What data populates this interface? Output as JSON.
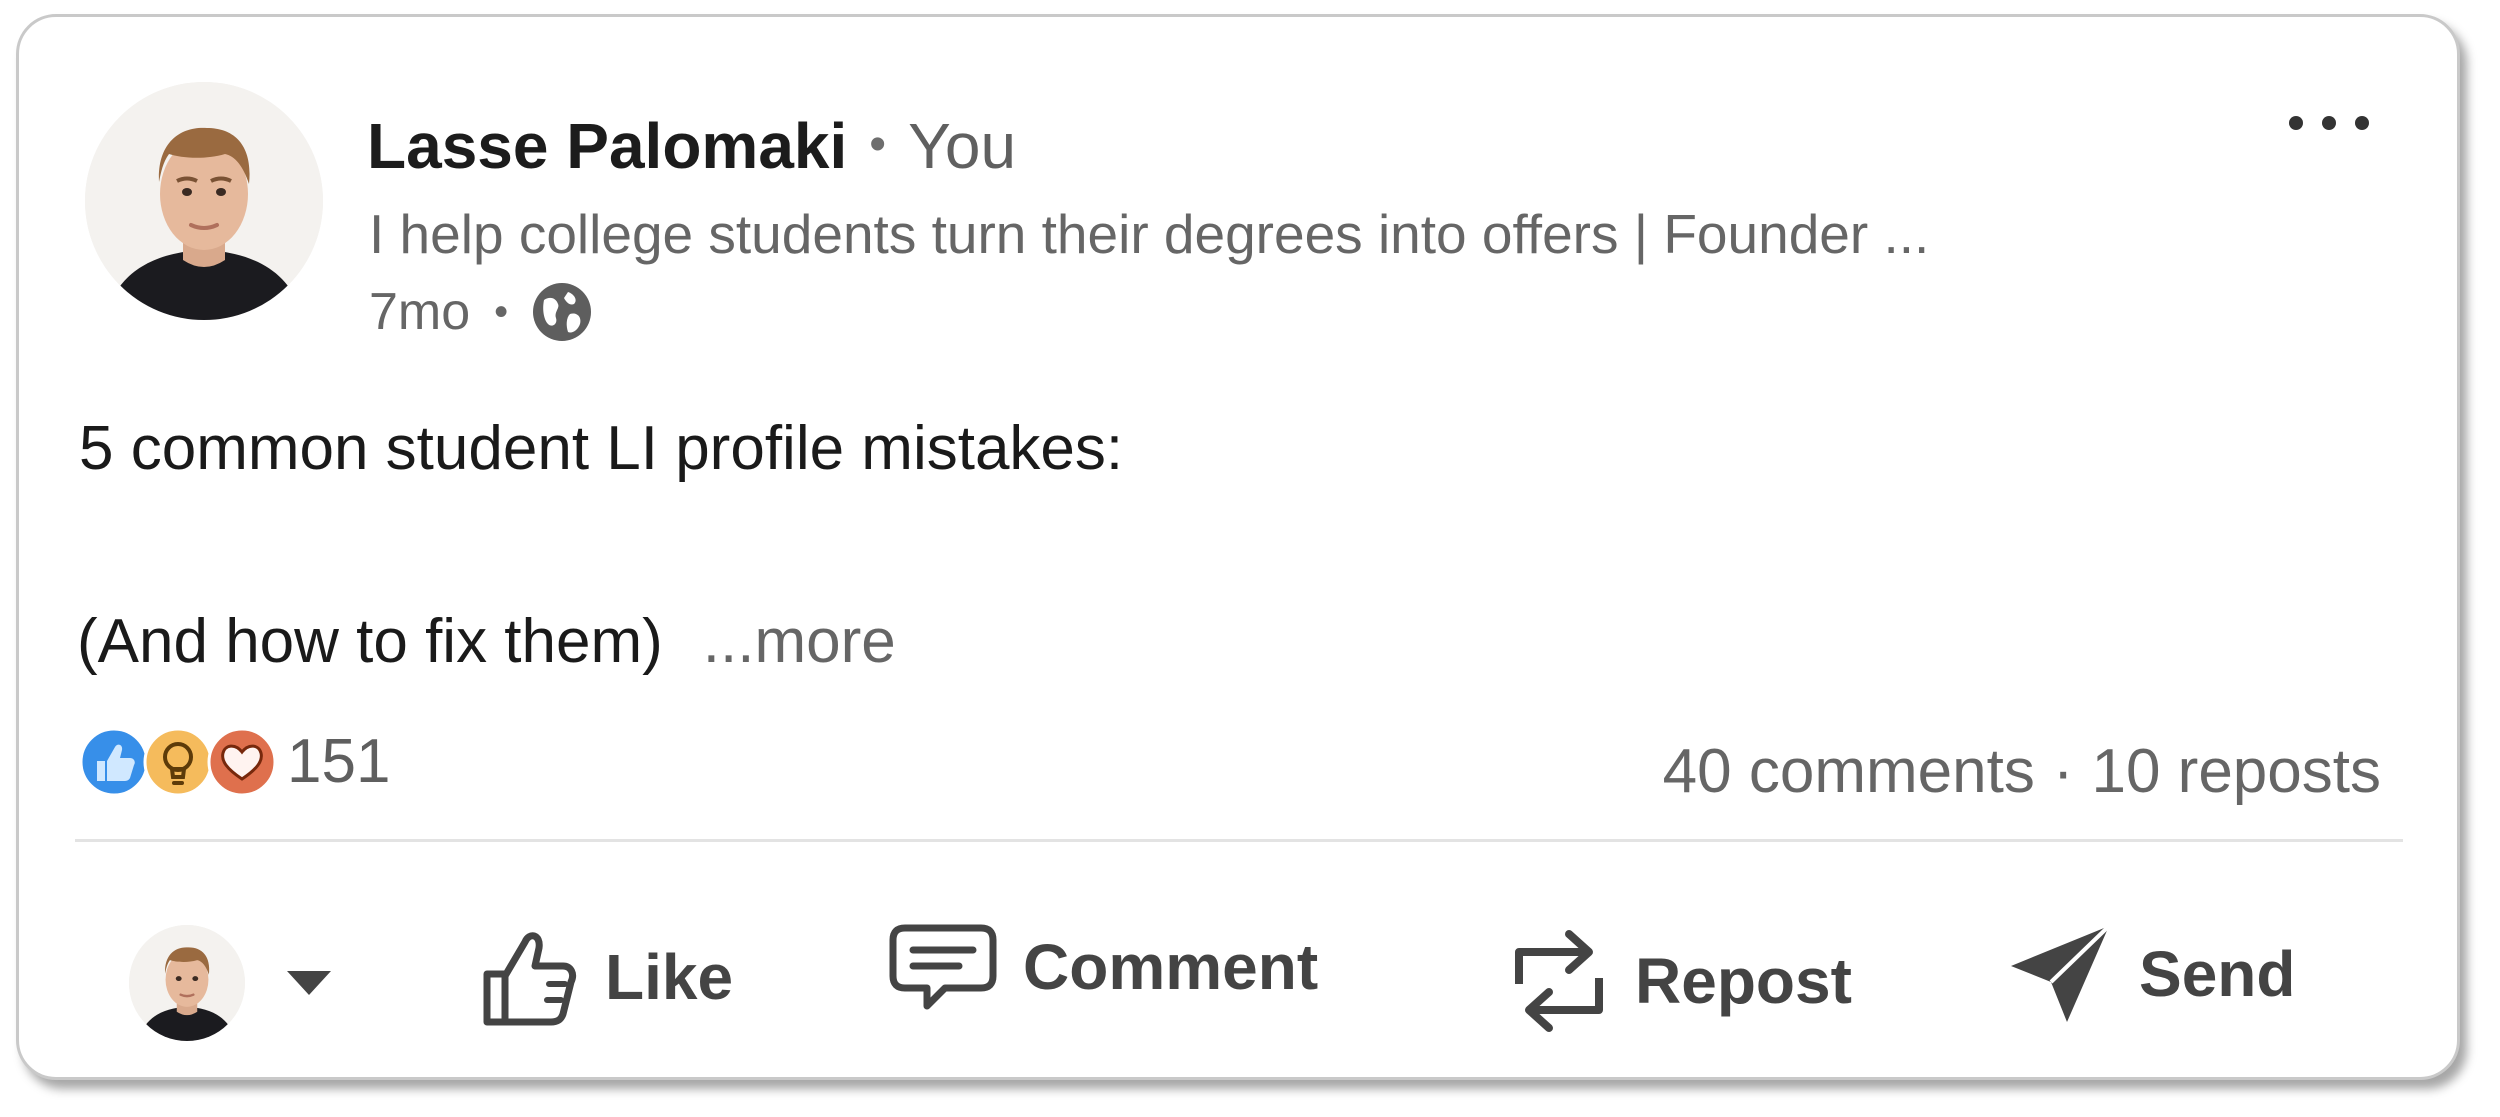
{
  "post": {
    "author": {
      "name": "Lasse Palomaki",
      "connection": "You",
      "headline": "I help college students turn their degrees into offers | Founder ...",
      "time": "7mo",
      "visibility_icon": "globe-icon"
    },
    "text_line1": "5 common student LI profile mistakes:",
    "text_line2": "(And how to fix them)",
    "see_more": "...more",
    "reactions": {
      "icons": [
        "like-reaction-icon",
        "insightful-reaction-icon",
        "love-reaction-icon"
      ],
      "count": "151"
    },
    "stats": {
      "comments": "40 comments",
      "reposts": "10 reposts"
    },
    "menu_icon": "more-options-icon"
  },
  "actions": {
    "like": "Like",
    "comment": "Comment",
    "repost": "Repost",
    "send": "Send"
  },
  "colors": {
    "like_blue": "#378fe9",
    "insightful_yellow": "#f5bb5c",
    "love_red": "#df704d",
    "text_primary": "#1a1a1a",
    "text_secondary": "#666666"
  }
}
